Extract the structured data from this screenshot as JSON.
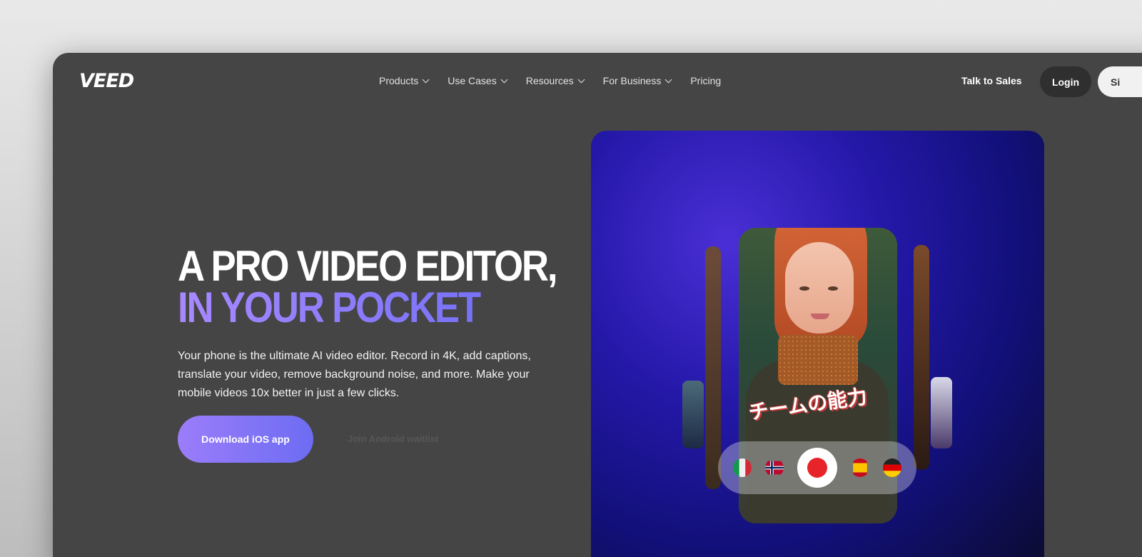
{
  "nav": {
    "logo": "VEED",
    "menu": [
      {
        "label": "Products"
      },
      {
        "label": "Use Cases"
      },
      {
        "label": "Resources"
      },
      {
        "label": "For Business"
      },
      {
        "label": "Pricing"
      }
    ],
    "talk_to_sales": "Talk to Sales",
    "login": "Login",
    "signup": "Si"
  },
  "hero": {
    "title_line1": "A PRO VIDEO EDITOR,",
    "title_line2": "IN YOUR POCKET",
    "description": "Your phone is the ultimate AI video editor. Record in 4K, add captions, translate your video, remove background noise, and more. Make your mobile videos 10x better in just a few clicks.",
    "primary_button": "Download iOS app",
    "secondary_button": "Join Android waitlist"
  },
  "media": {
    "caption": "チームの能力",
    "flags": [
      "italy-flag-icon",
      "norway-flag-icon",
      "record-button",
      "spain-flag-icon",
      "germany-flag-icon"
    ]
  },
  "colors": {
    "accent_start": "#9b7dfa",
    "accent_end": "#6d6cf2",
    "page_bg": "#454545",
    "record_red": "#e8242b"
  }
}
